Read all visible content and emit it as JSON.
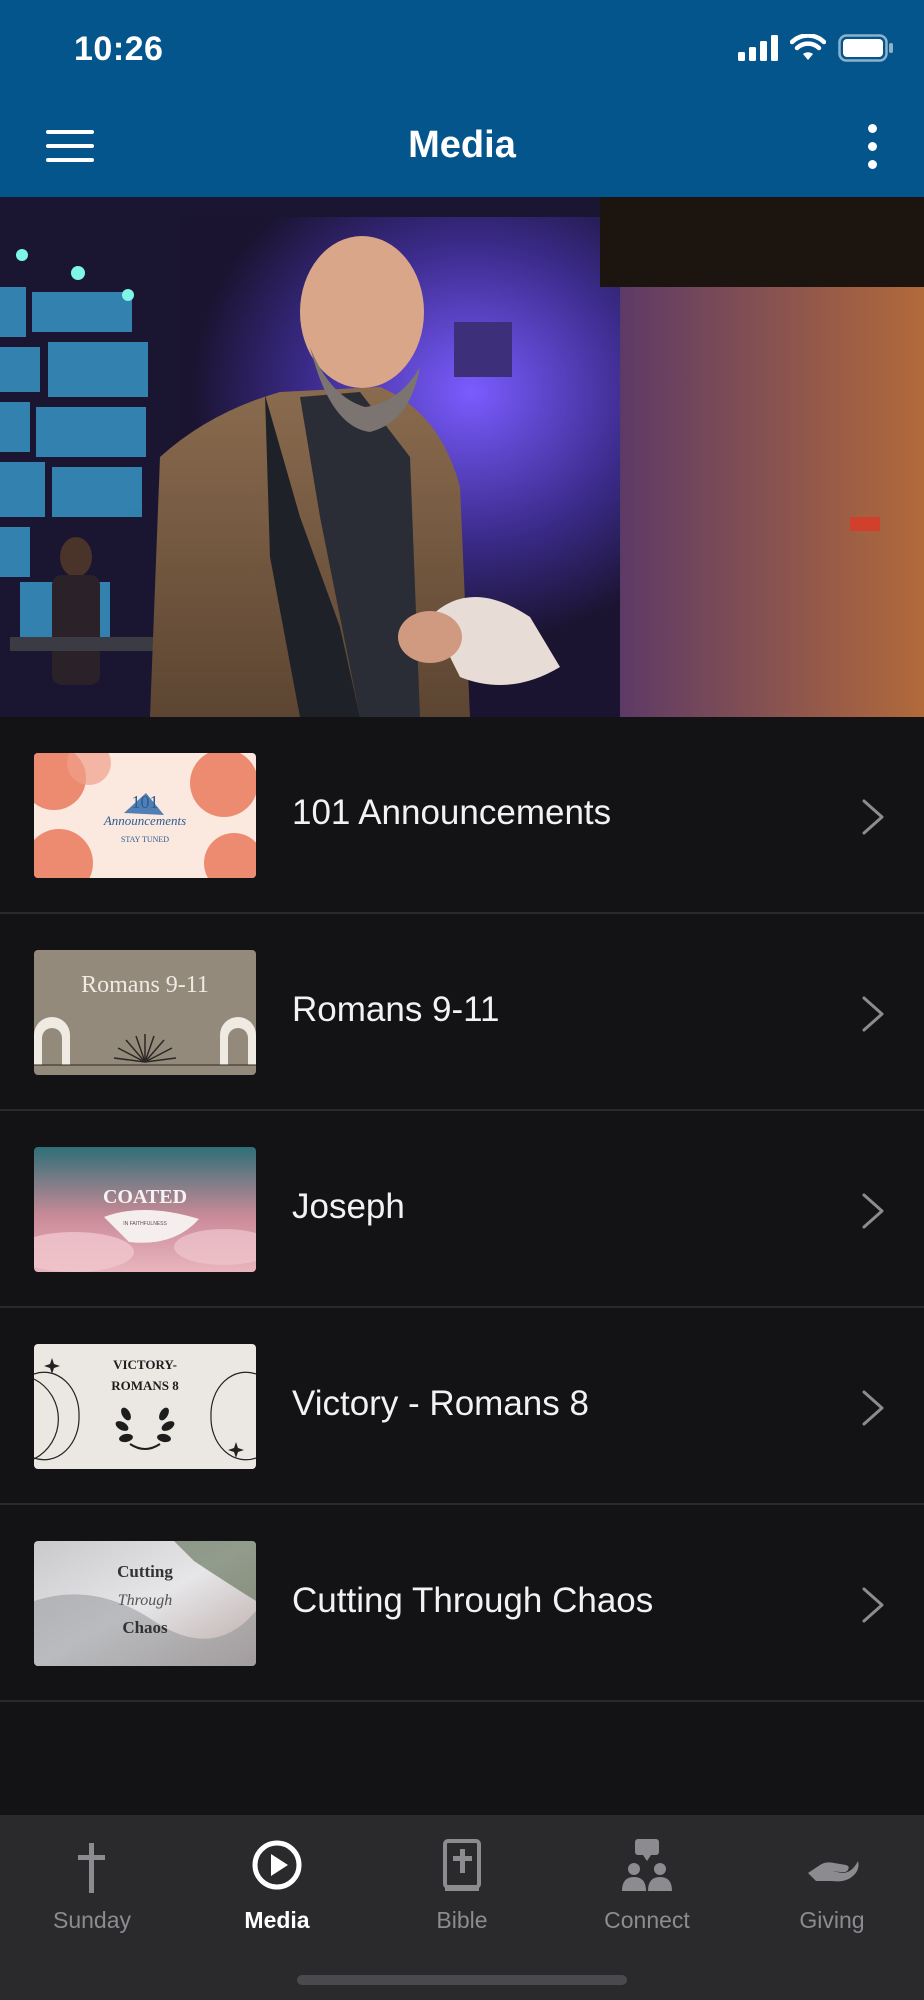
{
  "status": {
    "time": "10:26"
  },
  "header": {
    "title": "Media",
    "menu_icon": "hamburger-menu-icon",
    "more_icon": "more-vertical-icon"
  },
  "colors": {
    "header_bg": "#04558c",
    "list_bg": "#131315",
    "tabbar_bg": "#2a2a2d",
    "divider": "#2a2a2d"
  },
  "media_list": [
    {
      "title": "101 Announcements",
      "thumb_text": [
        "101",
        "Announcements",
        "STAY TUNED"
      ]
    },
    {
      "title": "Romans 9-11",
      "thumb_text": [
        "Romans 9-11"
      ]
    },
    {
      "title": "Joseph",
      "thumb_text": [
        "COATED",
        "IN FAITHFULNESS"
      ]
    },
    {
      "title": "Victory - Romans 8",
      "thumb_text": [
        "VICTORY-",
        "ROMANS 8"
      ]
    },
    {
      "title": "Cutting Through Chaos",
      "thumb_text": [
        "Cutting",
        "Through",
        "Chaos"
      ]
    }
  ],
  "tabs": [
    {
      "label": "Sunday",
      "icon": "cross-icon",
      "active": false
    },
    {
      "label": "Media",
      "icon": "play-circle-icon",
      "active": true
    },
    {
      "label": "Bible",
      "icon": "bible-icon",
      "active": false
    },
    {
      "label": "Connect",
      "icon": "connect-people-icon",
      "active": false
    },
    {
      "label": "Giving",
      "icon": "giving-hand-icon",
      "active": false
    }
  ]
}
